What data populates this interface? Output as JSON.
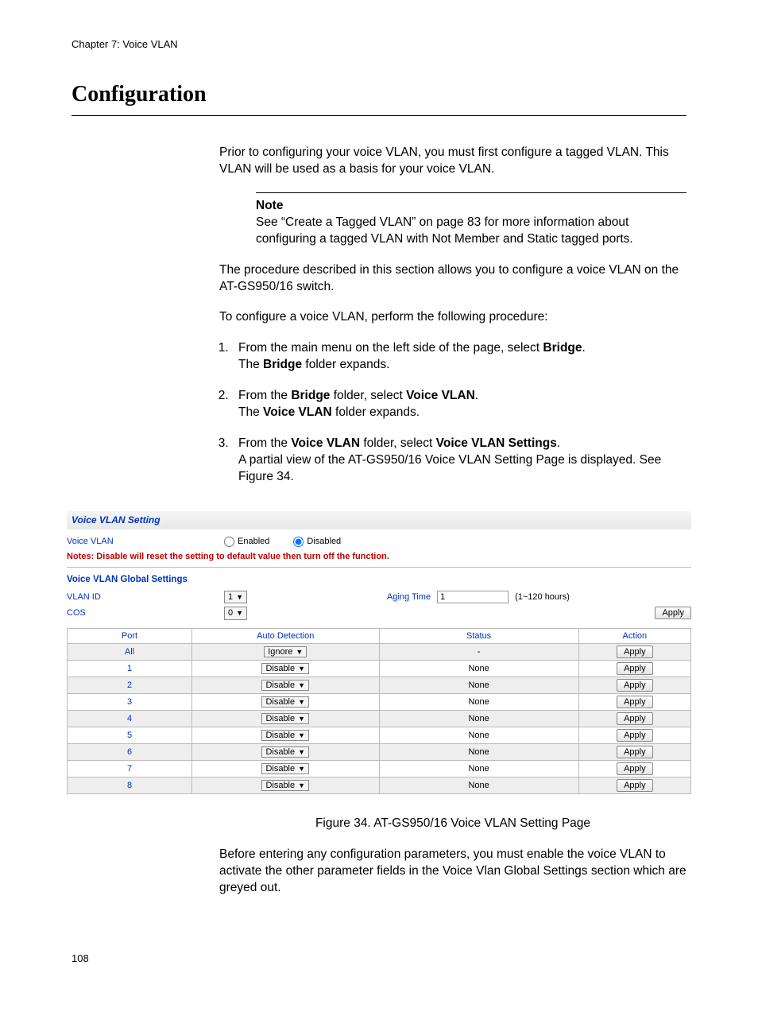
{
  "chapter": "Chapter 7: Voice VLAN",
  "title": "Configuration",
  "intro1": "Prior to configuring your voice VLAN, you must first configure a tagged VLAN. This VLAN will be used as a basis for your voice VLAN.",
  "note": {
    "label": "Note",
    "text": "See “Create a Tagged VLAN” on page 83 for more information about configuring a tagged VLAN with Not Member and Static tagged ports."
  },
  "intro2": "The procedure described in this section allows you to configure a voice VLAN on the AT-GS950/16 switch.",
  "intro3": "To configure a voice VLAN, perform the following procedure:",
  "steps": {
    "s1a": "From the main menu on the left side of the page, select ",
    "s1b": "Bridge",
    "s1c": ".",
    "s1d": "The ",
    "s1e": "Bridge",
    "s1f": " folder expands.",
    "s2a": "From the ",
    "s2b": "Bridge",
    "s2c": " folder, select ",
    "s2d": "Voice VLAN",
    "s2e": ".",
    "s2f": "The ",
    "s2g": "Voice VLAN",
    "s2h": " folder expands.",
    "s3a": "From the ",
    "s3b": "Voice VLAN",
    "s3c": " folder, select ",
    "s3d": "Voice VLAN Settings",
    "s3e": ".",
    "s3f": "A partial view of the AT-GS950/16 Voice VLAN Setting Page is displayed. See Figure 34."
  },
  "screenshot": {
    "panelTitle": "Voice VLAN Setting",
    "rowVoiceVlanLabel": "Voice VLAN",
    "radioEnabled": "Enabled",
    "radioDisabled": "Disabled",
    "warning": "Notes: Disable will reset the setting to default value then turn off the function.",
    "sectionGlobal": "Voice VLAN Global Settings",
    "labelVlanId": "VLAN ID",
    "valueVlanId": "1",
    "labelAging": "Aging Time",
    "valueAging": "1",
    "agingHint": "(1~120 hours)",
    "labelCos": "COS",
    "valueCos": "0",
    "applyLabel": "Apply",
    "columns": {
      "port": "Port",
      "auto": "Auto Detection",
      "status": "Status",
      "action": "Action"
    },
    "rows": [
      {
        "port": "All",
        "auto": "Ignore",
        "status": "-",
        "action": "Apply",
        "alt": true
      },
      {
        "port": "1",
        "auto": "Disable",
        "status": "None",
        "action": "Apply",
        "alt": false
      },
      {
        "port": "2",
        "auto": "Disable",
        "status": "None",
        "action": "Apply",
        "alt": true
      },
      {
        "port": "3",
        "auto": "Disable",
        "status": "None",
        "action": "Apply",
        "alt": false
      },
      {
        "port": "4",
        "auto": "Disable",
        "status": "None",
        "action": "Apply",
        "alt": true
      },
      {
        "port": "5",
        "auto": "Disable",
        "status": "None",
        "action": "Apply",
        "alt": false
      },
      {
        "port": "6",
        "auto": "Disable",
        "status": "None",
        "action": "Apply",
        "alt": true
      },
      {
        "port": "7",
        "auto": "Disable",
        "status": "None",
        "action": "Apply",
        "alt": false
      },
      {
        "port": "8",
        "auto": "Disable",
        "status": "None",
        "action": "Apply",
        "alt": true
      }
    ]
  },
  "figureCaption": "Figure 34. AT-GS950/16 Voice VLAN Setting Page",
  "outro": "Before entering any configuration parameters, you must enable the voice VLAN to activate the other parameter fields in the Voice Vlan Global Settings section which are greyed out.",
  "pageNumber": "108"
}
